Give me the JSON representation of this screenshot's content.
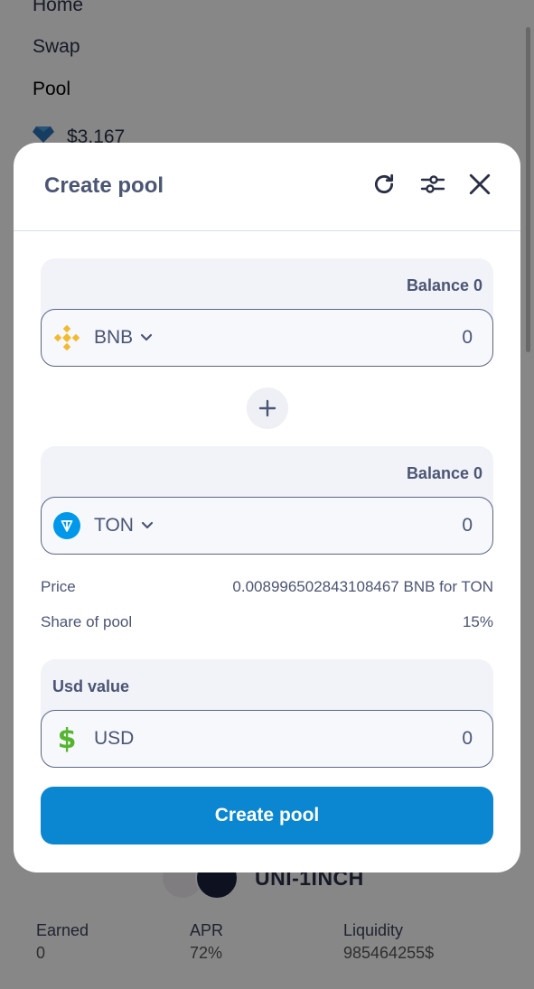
{
  "background": {
    "nav": {
      "home": "Home",
      "swap": "Swap",
      "pool": "Pool"
    },
    "balance": {
      "icon": "gem-icon",
      "value": "$3,167"
    },
    "pool_card": {
      "pair_name": "UNI-1INCH",
      "stats": [
        {
          "label": "Earned",
          "value": "0"
        },
        {
          "label": "APR",
          "value": "72%"
        },
        {
          "label": "Liquidity",
          "value": "985464255$"
        }
      ]
    }
  },
  "modal": {
    "title": "Create pool",
    "icons": {
      "refresh": "refresh-icon",
      "settings": "sliders-icon",
      "close": "close-icon"
    },
    "token_a": {
      "balance_label": "Balance 0",
      "symbol": "BNB",
      "amount": "0",
      "icon": "bnb-icon",
      "color": "#f3ba2f"
    },
    "token_b": {
      "balance_label": "Balance 0",
      "symbol": "TON",
      "amount": "0",
      "icon": "ton-icon",
      "color": "#0098ea"
    },
    "price": {
      "label": "Price",
      "value": "0.008996502843108467 BNB for TON"
    },
    "share": {
      "label": "Share of pool",
      "value": "15%"
    },
    "usd": {
      "label": "Usd value",
      "symbol": "USD",
      "amount": "0",
      "icon": "dollar-icon",
      "color": "#55b52f"
    },
    "create_button": "Create pool",
    "accent_color": "#0b86d0"
  }
}
